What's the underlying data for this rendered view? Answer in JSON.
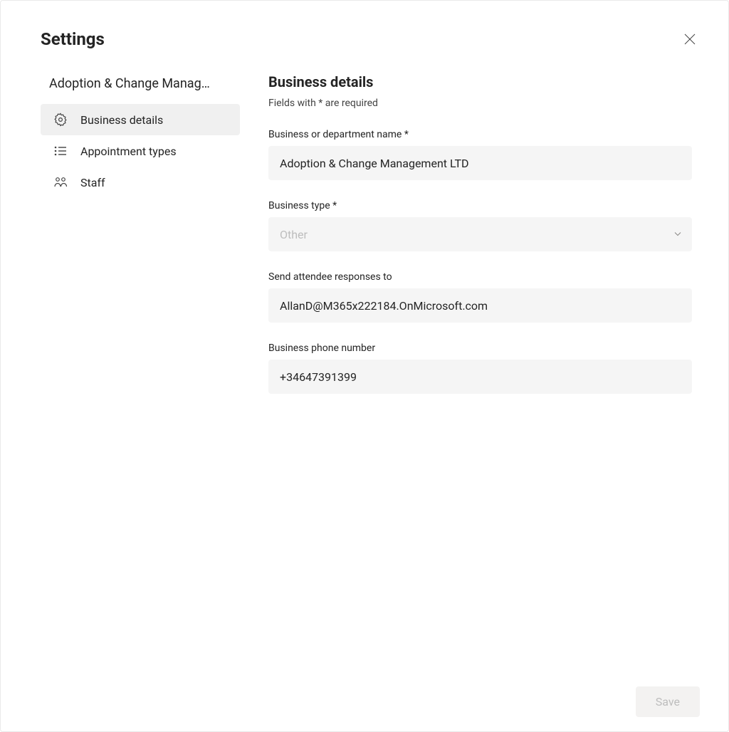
{
  "dialog": {
    "title": "Settings"
  },
  "sidebar": {
    "org_name": "Adoption & Change Manag…",
    "items": [
      {
        "label": "Business details"
      },
      {
        "label": "Appointment types"
      },
      {
        "label": "Staff"
      }
    ]
  },
  "main": {
    "section_title": "Business details",
    "hint": "Fields with * are required",
    "fields": {
      "business_name": {
        "label": "Business or department name *",
        "value": "Adoption & Change Management LTD"
      },
      "business_type": {
        "label": "Business type *",
        "placeholder": "Other",
        "value": "Other"
      },
      "responses_to": {
        "label": "Send attendee responses to",
        "value": "AllanD@M365x222184.OnMicrosoft.com"
      },
      "phone": {
        "label": "Business phone number",
        "value": "+34647391399"
      }
    }
  },
  "footer": {
    "save_label": "Save"
  }
}
